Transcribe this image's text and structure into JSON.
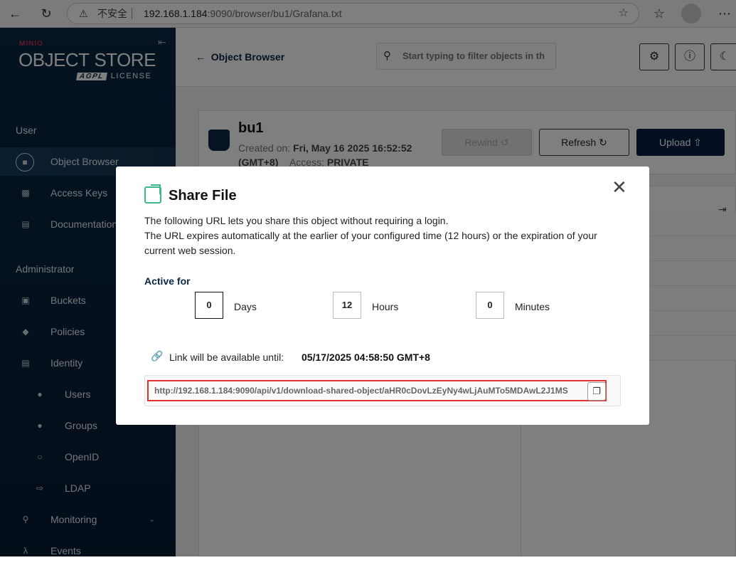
{
  "browser": {
    "back_icon": "arrow-left-icon",
    "reload_icon": "reload-icon",
    "insecure_label": "不安全",
    "url_host": "192.168.1.184",
    "url_rest": ":9090/browser/bu1/Grafana.txt",
    "star_icon": "star-icon"
  },
  "brand": {
    "top": "MINIO",
    "object": "OBJECT",
    "store": "STORE",
    "agpl": "AGPL",
    "license": "LICENSE"
  },
  "sidebar": {
    "user_heading": "User",
    "admin_heading": "Administrator",
    "user_items": [
      {
        "label": "Object Browser",
        "icon": "object-browser-icon"
      },
      {
        "label": "Access Keys",
        "icon": "access-keys-icon"
      },
      {
        "label": "Documentation",
        "icon": "documentation-icon"
      }
    ],
    "admin_items": [
      {
        "label": "Buckets",
        "icon": "bucket-icon"
      },
      {
        "label": "Policies",
        "icon": "policy-icon"
      },
      {
        "label": "Identity",
        "icon": "identity-icon"
      },
      {
        "label": "Users",
        "icon": "user-icon"
      },
      {
        "label": "Groups",
        "icon": "groups-icon"
      },
      {
        "label": "OpenID",
        "icon": "openid-icon"
      },
      {
        "label": "LDAP",
        "icon": "ldap-icon"
      },
      {
        "label": "Monitoring",
        "icon": "monitoring-icon"
      },
      {
        "label": "Events",
        "icon": "lambda-icon"
      }
    ]
  },
  "topbar": {
    "back_label": "Object Browser",
    "search_placeholder": "Start typing to filter objects in th"
  },
  "bucket": {
    "name": "bu1",
    "created_label": "Created on:",
    "created_value": "Fri, May 16 2025 16:52:52",
    "tz": "(GMT+8)",
    "access_label": "Access:",
    "access_value": "PRIVATE"
  },
  "buttons": {
    "rewind": "Rewind",
    "refresh": "Refresh",
    "upload": "Upload"
  },
  "modal": {
    "title": "Share File",
    "desc1": "The following URL lets you share this object without requiring a login.",
    "desc2": "The URL expires automatically at the earlier of your configured time (12 hours) or the expiration of your current web session.",
    "active_for": "Active for",
    "days_value": "0",
    "days_label": "Days",
    "hours_value": "12",
    "hours_label": "Hours",
    "minutes_value": "0",
    "minutes_label": "Minutes",
    "available_label": "Link will be available until:",
    "available_date": "05/17/2025 04:58:50 GMT+8",
    "share_url": "http://192.168.1.184:9090/api/v1/download-shared-object/aHR0cDovLzEyNy4wLjAuMTo5MDAwL2J1MS"
  }
}
